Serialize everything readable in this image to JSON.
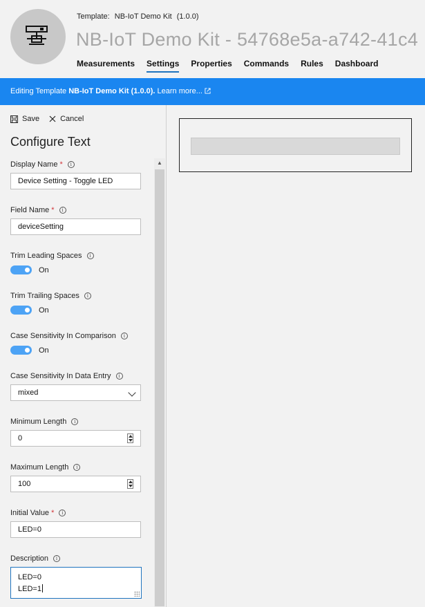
{
  "header": {
    "template_label": "Template:",
    "template_name": "NB-IoT Demo Kit",
    "template_version": "(1.0.0)",
    "device_title": "NB-IoT Demo Kit - 54768e5a-a742-41c4",
    "tabs": [
      {
        "label": "Measurements",
        "active": false
      },
      {
        "label": "Settings",
        "active": true
      },
      {
        "label": "Properties",
        "active": false
      },
      {
        "label": "Commands",
        "active": false
      },
      {
        "label": "Rules",
        "active": false
      },
      {
        "label": "Dashboard",
        "active": false
      }
    ]
  },
  "banner": {
    "prefix": "Editing Template ",
    "template_bold": "NB-IoT Demo Kit (1.0.0).",
    "link": " Learn more...",
    "color": "#1a86f0"
  },
  "toolbar": {
    "save_label": "Save",
    "cancel_label": "Cancel"
  },
  "panel": {
    "title": "Configure Text",
    "display_name": {
      "label": "Display Name",
      "value": "Device Setting - Toggle LED",
      "required": "*"
    },
    "field_name": {
      "label": "Field Name",
      "value": "deviceSetting",
      "required": "*"
    },
    "trim_leading": {
      "label": "Trim Leading Spaces",
      "state": "On"
    },
    "trim_trailing": {
      "label": "Trim Trailing Spaces",
      "state": "On"
    },
    "case_comparison": {
      "label": "Case Sensitivity In Comparison",
      "state": "On"
    },
    "case_entry": {
      "label": "Case Sensitivity In Data Entry",
      "value": "mixed"
    },
    "min_length": {
      "label": "Minimum Length",
      "value": "0"
    },
    "max_length": {
      "label": "Maximum Length",
      "value": "100"
    },
    "initial_value": {
      "label": "Initial Value",
      "value": "LED=0",
      "required": "*"
    },
    "description": {
      "label": "Description",
      "line1": "LED=0",
      "line2": "LED=1"
    }
  },
  "icons": {
    "device": "device-network-icon",
    "save": "floppy-disk-icon",
    "cancel": "close-icon",
    "info": "info-icon",
    "external": "external-link-icon"
  },
  "colors": {
    "accent": "#1e73be",
    "toggle_on": "#4da3f5",
    "required": "#d13438"
  }
}
